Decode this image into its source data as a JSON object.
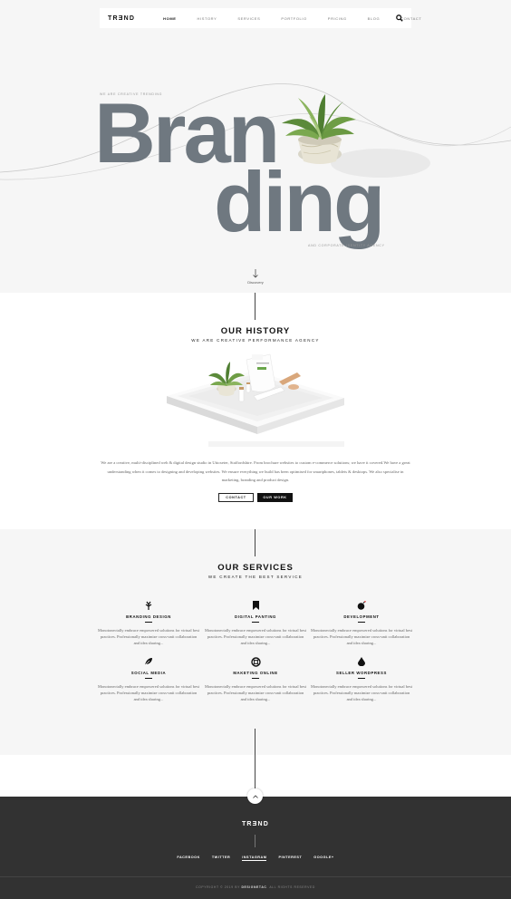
{
  "nav": {
    "logo": "TRƎND",
    "items": [
      {
        "label": "HOME",
        "active": true
      },
      {
        "label": "HISTORY",
        "active": false
      },
      {
        "label": "SERVICES",
        "active": false
      },
      {
        "label": "PORTFOLIO",
        "active": false
      },
      {
        "label": "PRICING",
        "active": false
      },
      {
        "label": "BLOG",
        "active": false
      },
      {
        "label": "CONTACT",
        "active": false
      }
    ],
    "search_icon": "search-icon"
  },
  "hero": {
    "kicker": "WE ARE CREATIVE TRENDING",
    "word_line1": "Bran",
    "word_line2": "ding",
    "tagline": "AND CORPORATE IDENTITY AGENCY",
    "discover": "Discovery"
  },
  "history": {
    "title": "OUR HISTORY",
    "subtitle": "WE ARE CREATIVE PERFORMANCE AGENCY",
    "paragraph": "We are a creative, multi-disciplined web & digital design studio in Uttoxeter, Staffordshire. From brochure websites to custom e-commerce solutions; we have it covered.We have a great understanding when it comes to designing and developing websites. We ensure everything we build has been optimised for smartphones, tablets & desktops. We also specialise in marketing, branding and product design.",
    "contact_button": "CONTACT",
    "work_button": "OUR WORK"
  },
  "services": {
    "title": "OUR SERVICES",
    "subtitle": "WE CREATE THE BEST SERVICE",
    "items": [
      {
        "name": "BRANDING DESIGN",
        "icon": "leaf-icon",
        "text": "Monotonectally embrace empowered solutions for virtual best practices. Professionally maximize cross-unit collaboration and idea sharing..."
      },
      {
        "name": "DIGITAL PANTING",
        "icon": "bookmark-icon",
        "text": "Monotonectally embrace empowered solutions for virtual best practices. Professionally maximize cross-unit collaboration and idea sharing..."
      },
      {
        "name": "DEVELOPMENT",
        "icon": "bomb-icon",
        "text": "Monotonectally embrace empowered solutions for virtual best practices. Professionally maximize cross-unit collaboration and idea sharing..."
      },
      {
        "name": "SOCIAL MEDIA",
        "icon": "feather-icon",
        "text": "Monotonectally embrace empowered solutions for virtual best practices. Professionally maximize cross-unit collaboration and idea sharing..."
      },
      {
        "name": "MAKETING ONLINE",
        "icon": "lifebuoy-icon",
        "text": "Monotonectally embrace empowered solutions for virtual best practices. Professionally maximize cross-unit collaboration and idea sharing..."
      },
      {
        "name": "SELLER WORDPRESS",
        "icon": "drop-icon",
        "text": "Monotonectally embrace empowered solutions for virtual best practices. Professionally maximize cross-unit collaboration and idea sharing..."
      }
    ]
  },
  "footer": {
    "logo": "TRƎND",
    "social": [
      {
        "label": "FACEBOOK",
        "active": false
      },
      {
        "label": "TWITTER",
        "active": false
      },
      {
        "label": "INSTAGRAM",
        "active": true
      },
      {
        "label": "PINTEREST",
        "active": false
      },
      {
        "label": "GOOGLE+",
        "active": false
      }
    ],
    "copyright_prefix": "COPYRIGHT © 2019 BY",
    "copyright_brand": "DESIGNETAC",
    "copyright_suffix": ". ALL RIGHTS RESERVED"
  }
}
